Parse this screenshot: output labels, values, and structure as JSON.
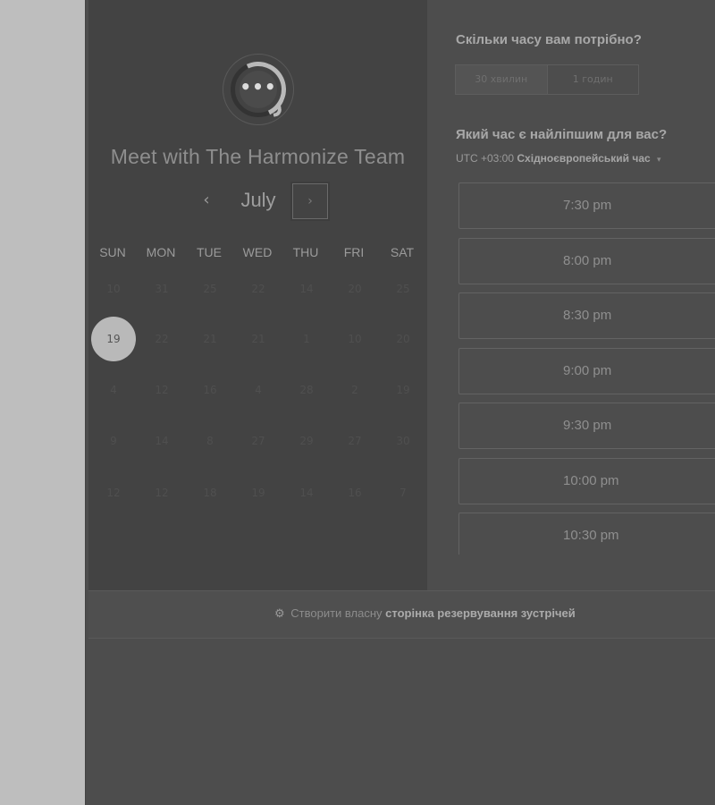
{
  "left": {
    "logo_glyph": "•••",
    "title": "Meet with The Harmonize Team",
    "month": "July",
    "prev_glyph": "‹",
    "next_glyph": "›",
    "weekdays": [
      "SUN",
      "MON",
      "TUE",
      "WED",
      "THU",
      "FRI",
      "SAT"
    ],
    "days": [
      [
        "10",
        "31",
        "25",
        "22",
        "14",
        "20",
        "25"
      ],
      [
        "19",
        "22",
        "21",
        "21",
        "1",
        "10",
        "20"
      ],
      [
        "4",
        "12",
        "16",
        "4",
        "28",
        "2",
        "19"
      ],
      [
        "9",
        "14",
        "8",
        "27",
        "29",
        "27",
        "30"
      ],
      [
        "12",
        "12",
        "18",
        "19",
        "14",
        "16",
        "7"
      ]
    ],
    "selected_day": "19"
  },
  "right": {
    "duration_question": "Скільки часу вам потрібно?",
    "durations": [
      "30 хвилин",
      "1 годин"
    ],
    "selected_duration": "30 хвилин",
    "time_question": "Який час є найліпшим для вас?",
    "tz_offset": "UTC +03:00",
    "tz_name": "Східноєвропейський час",
    "tz_caret": "▾",
    "slots": [
      "7:30 pm",
      "8:00 pm",
      "8:30 pm",
      "9:00 pm",
      "9:30 pm",
      "10:00 pm",
      "10:30 pm"
    ]
  },
  "footer": {
    "icon": "hubspot-sprocket-icon",
    "prefix": "Створити власну",
    "bold": "сторінка резервування зустрічей"
  }
}
